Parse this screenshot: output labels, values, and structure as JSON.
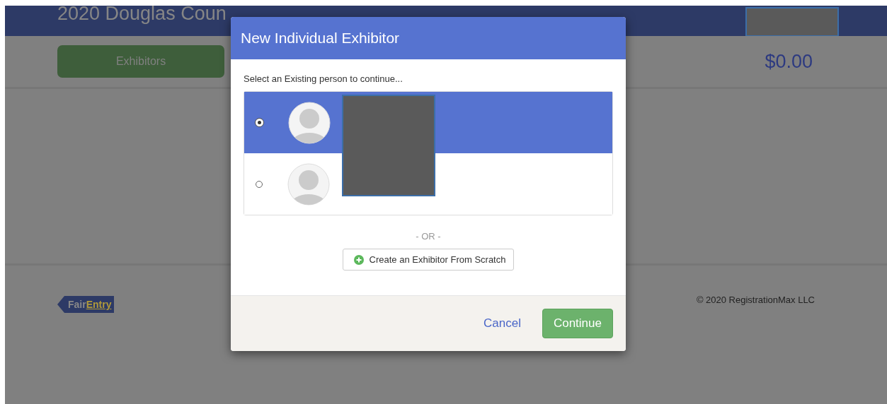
{
  "page": {
    "title": "2020 Douglas Coun",
    "nav_button": "Exhibitors",
    "total": "$0.00",
    "logo": {
      "first": "Fair",
      "second": "Entry"
    },
    "copyright": "© 2020 RegistrationMax LLC"
  },
  "dialog": {
    "title": "New Individual Exhibitor",
    "prompt": "Select an Existing person to continue...",
    "persons": [
      {
        "selected": true
      },
      {
        "selected": false
      }
    ],
    "separator": "- OR -",
    "create_button": "Create an Exhibitor From Scratch",
    "cancel": "Cancel",
    "continue": "Continue"
  }
}
